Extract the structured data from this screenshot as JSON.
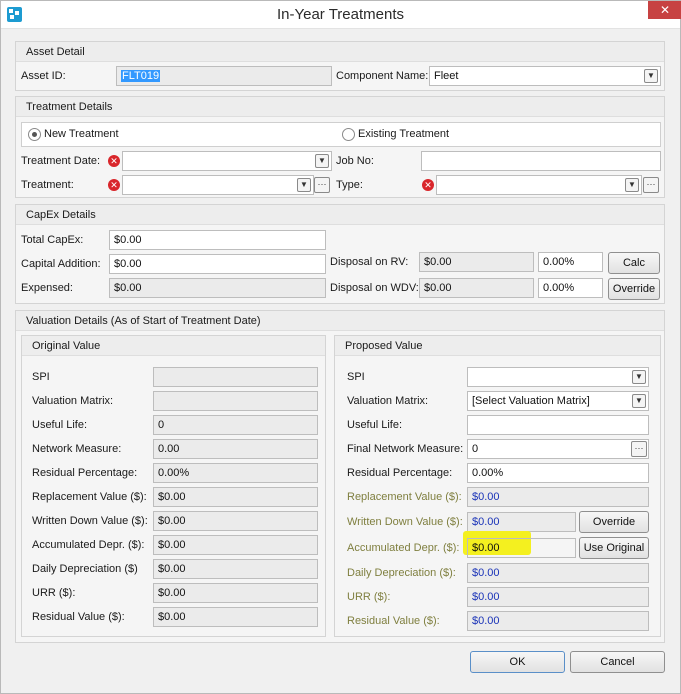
{
  "window": {
    "title": "In-Year Treatments",
    "close_glyph": "✕"
  },
  "asset_detail": {
    "header": "Asset Detail",
    "asset_id_label": "Asset ID:",
    "asset_id_value": "FLT019",
    "component_label": "Component Name:",
    "component_value": "Fleet"
  },
  "treatment_details": {
    "header": "Treatment Details",
    "new_treatment_label": "New Treatment",
    "existing_treatment_label": "Existing Treatment",
    "selected": "New Treatment",
    "treatment_date_label": "Treatment Date:",
    "treatment_date_value": "",
    "job_no_label": "Job No:",
    "job_no_value": "",
    "treatment_label": "Treatment:",
    "treatment_value": "",
    "type_label": "Type:",
    "type_value": ""
  },
  "capex": {
    "header": "CapEx Details",
    "total_capex_label": "Total CapEx:",
    "total_capex_value": "$0.00",
    "capital_addition_label": "Capital Addition:",
    "capital_addition_value": "$0.00",
    "expensed_label": "Expensed:",
    "expensed_value": "$0.00",
    "disposal_rv_label": "Disposal on RV:",
    "disposal_rv_value": "$0.00",
    "disposal_rv_pct": "0.00%",
    "disposal_wdv_label": "Disposal on WDV:",
    "disposal_wdv_value": "$0.00",
    "disposal_wdv_pct": "0.00%",
    "calc_button": "Calc",
    "override_button": "Override"
  },
  "valuation": {
    "header": "Valuation Details (As of Start of Treatment Date)",
    "original": {
      "header": "Original Value",
      "rows": [
        {
          "label": "SPI",
          "value": ""
        },
        {
          "label": "Valuation Matrix:",
          "value": ""
        },
        {
          "label": "Useful Life:",
          "value": "0"
        },
        {
          "label": "Network Measure:",
          "value": "0.00"
        },
        {
          "label": "Residual Percentage:",
          "value": "0.00%"
        },
        {
          "label": "Replacement Value ($):",
          "value": "$0.00"
        },
        {
          "label": "Written Down Value ($):",
          "value": "$0.00"
        },
        {
          "label": "Accumulated Depr. ($):",
          "value": "$0.00"
        },
        {
          "label": "Daily Depreciation ($)",
          "value": "$0.00"
        },
        {
          "label": "URR ($):",
          "value": "$0.00"
        },
        {
          "label": "Residual Value ($):",
          "value": "$0.00"
        }
      ]
    },
    "proposed": {
      "header": "Proposed Value",
      "spi_label": "SPI",
      "spi_value": "",
      "matrix_label": "Valuation Matrix:",
      "matrix_value": "[Select Valuation Matrix]",
      "useful_life_label": "Useful Life:",
      "useful_life_value": "",
      "final_network_label": "Final Network Measure:",
      "final_network_value": "0",
      "residual_pct_label": "Residual Percentage:",
      "residual_pct_value": "0.00%",
      "replacement_label": "Replacement Value ($):",
      "replacement_value": "$0.00",
      "wdv_label": "Written Down Value ($):",
      "wdv_value": "$0.00",
      "wdv_button": "Override",
      "accum_label": "Accumulated Depr. ($):",
      "accum_value": "$0.00",
      "accum_button": "Use Original",
      "daily_label": "Daily Depreciation ($):",
      "daily_value": "$0.00",
      "urr_label": "URR ($):",
      "urr_value": "$0.00",
      "residual_label": "Residual Value ($):",
      "residual_value": "$0.00"
    }
  },
  "footer": {
    "ok_button": "OK",
    "cancel_button": "Cancel"
  },
  "colors": {
    "accent_blue": "#1a33b8",
    "olive_label": "#7f7f3f",
    "highlight_yellow": "#f4f01f",
    "error_red": "#d9262b"
  }
}
